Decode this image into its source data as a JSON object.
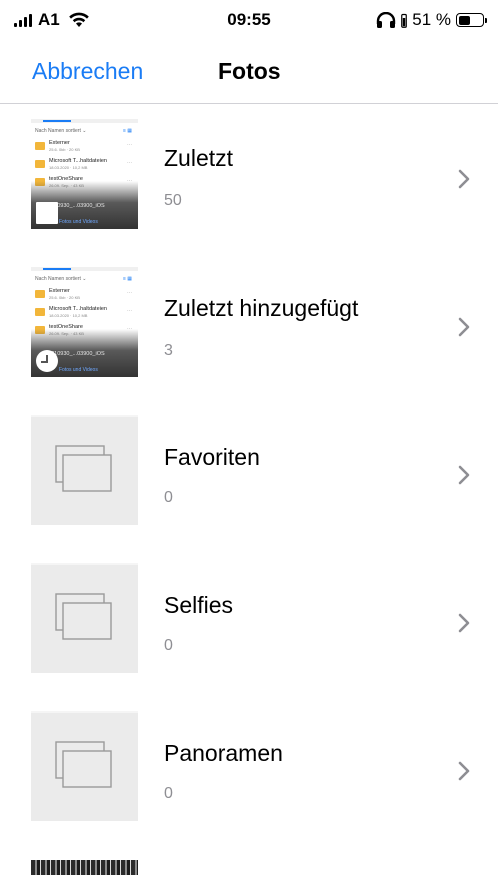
{
  "status_bar": {
    "carrier": "A1",
    "time": "09:55",
    "battery_percent": "51 %",
    "battery_level": 0.51
  },
  "nav": {
    "cancel_label": "Abbrechen",
    "title": "Fotos"
  },
  "albums": [
    {
      "title": "Zuletzt",
      "count": "50",
      "thumb": {
        "header": "Nach Namen sortiert ⌄",
        "rows": [
          {
            "name": "Externer",
            "meta": "25.6. 0kb · 20 KB"
          },
          {
            "name": "Microsoft T...haltdateien",
            "meta": "18.03.2020 · 10,2 MB"
          },
          {
            "name": "testOneShare",
            "meta": "26.09. Sep. · 43 KB"
          }
        ],
        "fade_name": "20210930_...03900_iOS",
        "fade_label": "Fotos und Videos"
      }
    },
    {
      "title": "Zuletzt hinzugefügt",
      "count": "3",
      "thumb": {
        "header": "Nach Namen sortiert ⌄",
        "rows": [
          {
            "name": "Externer",
            "meta": "25.6. 0kb · 20 KB"
          },
          {
            "name": "Microsoft T...haltdateien",
            "meta": "18.03.2020 · 10,2 MB"
          },
          {
            "name": "testOneShare",
            "meta": "26.09. Sep. · 43 KB"
          }
        ],
        "fade_name": "20210930_...03900_iOS",
        "fade_label": "Fotos und Videos"
      }
    },
    {
      "title": "Favoriten",
      "count": "0"
    },
    {
      "title": "Selfies",
      "count": "0"
    },
    {
      "title": "Panoramen",
      "count": "0"
    }
  ],
  "colors": {
    "accent": "#1a7cf5",
    "secondary_text": "#8e8e93",
    "chevron": "#8e8e93",
    "separator": "#d1d1d6",
    "empty_thumb": "#ebebeb"
  }
}
